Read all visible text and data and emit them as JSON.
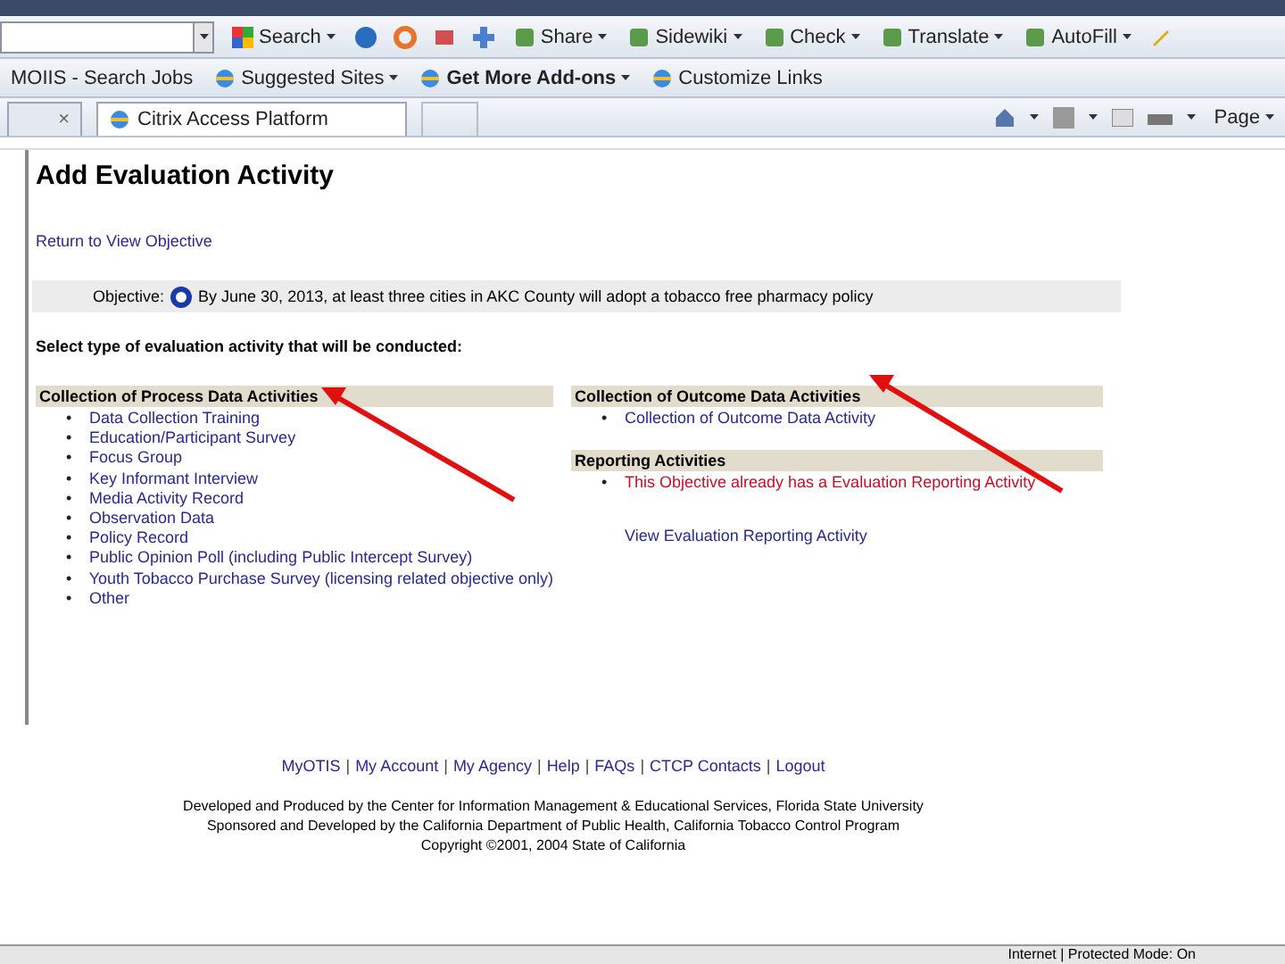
{
  "toolbar": {
    "items": [
      {
        "kind": "search",
        "label": "Search"
      },
      {
        "kind": "icons"
      },
      {
        "kind": "menu",
        "label": "Share"
      },
      {
        "kind": "menu",
        "label": "Sidewiki"
      },
      {
        "kind": "menu",
        "label": "Check"
      },
      {
        "kind": "menu",
        "label": "Translate"
      },
      {
        "kind": "menu",
        "label": "AutoFill"
      }
    ]
  },
  "favorites": [
    {
      "label": "MOIIS - Search Jobs",
      "bold": false,
      "menu": false
    },
    {
      "label": "Suggested Sites",
      "bold": false,
      "menu": true
    },
    {
      "label": "Get More Add-ons",
      "bold": true,
      "menu": true
    },
    {
      "label": "Customize Links",
      "bold": false,
      "menu": false
    }
  ],
  "tabs": [
    {
      "selected": false,
      "close": "×"
    },
    {
      "label": "Citrix Access Platform",
      "selected": true
    }
  ],
  "command_bar": {
    "page_label": "Page"
  },
  "page": {
    "title": "Add Evaluation Activity",
    "back_link": "Return to View Objective",
    "objective_label": "Objective:",
    "objective_text": "By June 30, 2013, at least three cities in AKC County will adopt a tobacco free pharmacy policy",
    "prompt": "Select type of evaluation activity that will be conducted:",
    "bullet": "•",
    "process": {
      "heading": "Collection of Process Data Activities",
      "items": [
        "Data Collection Training",
        "Education/Participant Survey",
        "Focus Group",
        "Key Informant Interview",
        "Media Activity Record",
        "Observation Data",
        "Policy Record",
        "Public Opinion Poll (including Public Intercept Survey)",
        "Youth Tobacco Purchase Survey (licensing related objective only)",
        "Other"
      ]
    },
    "outcome": {
      "heading": "Collection of Outcome Data Activities",
      "items": [
        "Collection of Outcome Data Activity"
      ]
    },
    "reporting": {
      "heading": "Reporting Activities",
      "notice": "This Objective already has a Evaluation Reporting Activity",
      "link": "View Evaluation Reporting Activity"
    }
  },
  "footer": {
    "separator": "|",
    "links": [
      "MyOTIS",
      "My Account",
      "My Agency",
      "Help",
      "FAQs",
      "CTCP Contacts",
      "Logout"
    ],
    "credits": [
      "Developed and Produced by the Center for Information Management & Educational Services, Florida State University",
      "Sponsored and Developed by the California Department of Public Health, California Tobacco Control Program",
      "Copyright ©2001, 2004 State of California"
    ]
  },
  "status_bar": {
    "zone": "Internet | Protected Mode: On"
  }
}
